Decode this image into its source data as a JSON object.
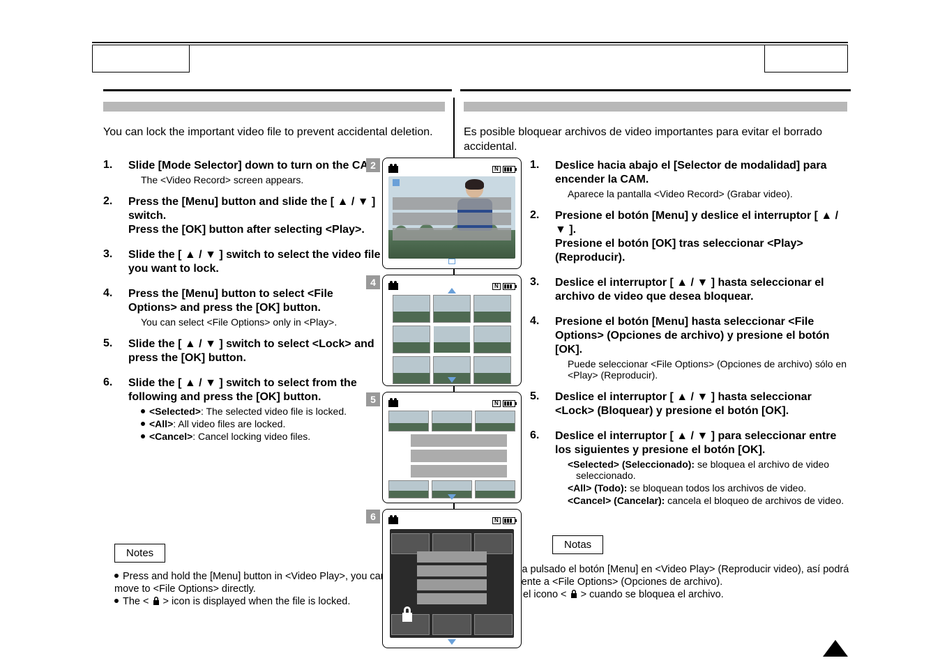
{
  "en": {
    "intro": "You can lock the important video file to prevent accidental deletion.",
    "steps": [
      {
        "head": "Slide [Mode Selector] down to turn on the CAM.",
        "desc": "The <Video Record> screen appears."
      },
      {
        "head": "Press the [Menu] button and slide the [ ▲ / ▼ ] switch.\nPress the [OK] button after selecting <Play>."
      },
      {
        "head": "Slide the [ ▲ / ▼ ] switch to select the video file you want to lock."
      },
      {
        "head": "Press the [Menu] button to select <File Options> and press the [OK] button.",
        "desc": "You can select <File Options> only in <Play>."
      },
      {
        "head": "Slide the [ ▲ / ▼ ] switch to select <Lock> and press the [OK] button."
      },
      {
        "head": "Slide the [ ▲ / ▼ ] switch to select from the following and press the [OK] button.",
        "opts": [
          {
            "k": "<Selected>",
            "v": ": The selected video file is locked."
          },
          {
            "k": "<All>",
            "v": ": All video files are locked."
          },
          {
            "k": "<Cancel>",
            "v": ": Cancel locking video files."
          }
        ]
      }
    ],
    "notes_label": "Notes",
    "notes": [
      "Press and hold the [Menu] button in <Video Play>, you can move to <File Options> directly.",
      "The < 🔒 > icon is displayed when the file is locked."
    ]
  },
  "es": {
    "intro": "Es posible bloquear archivos de video importantes para evitar el borrado accidental.",
    "steps": [
      {
        "head": "Deslice hacia abajo el [Selector de modalidad] para encender la CAM.",
        "desc": "Aparece la pantalla <Video Record> (Grabar video)."
      },
      {
        "head": "Presione el botón [Menu] y deslice el interruptor [ ▲ / ▼ ].\nPresione el botón [OK] tras seleccionar <Play> (Reproducir)."
      },
      {
        "head": "Deslice el interruptor [ ▲ / ▼ ] hasta seleccionar el archivo de video que desea bloquear."
      },
      {
        "head": "Presione el botón [Menu] hasta seleccionar <File Options> (Opciones de archivo) y presione el botón [OK].",
        "desc": "Puede seleccionar <File Options> (Opciones de archivo) sólo en <Play> (Reproducir)."
      },
      {
        "head": "Deslice el interruptor [ ▲ / ▼ ] hasta seleccionar <Lock> (Bloquear) y presione el botón [OK]."
      },
      {
        "head": "Deslice el interruptor [ ▲ / ▼ ] para seleccionar entre los siguientes y presione el botón [OK].",
        "opts": [
          {
            "k": "<Selected> (Seleccionado):",
            "v": " se bloquea el archivo de video seleccionado."
          },
          {
            "k": "<All> (Todo):",
            "v": " se bloquean todos los archivos de video."
          },
          {
            "k": "<Cancel> (Cancelar):",
            "v": " cancela el bloqueo de archivos de video."
          }
        ]
      }
    ],
    "notes_label": "Notas",
    "notes": [
      "Mantenga pulsado el botón [Menu] en <Video Play> (Reproducir video), así podrá ir directamente a <File Options> (Opciones de archivo).",
      "Aparece el icono < 🔒 > cuando se bloquea el archivo."
    ]
  },
  "shot_numbers": [
    "2",
    "4",
    "5",
    "6"
  ]
}
